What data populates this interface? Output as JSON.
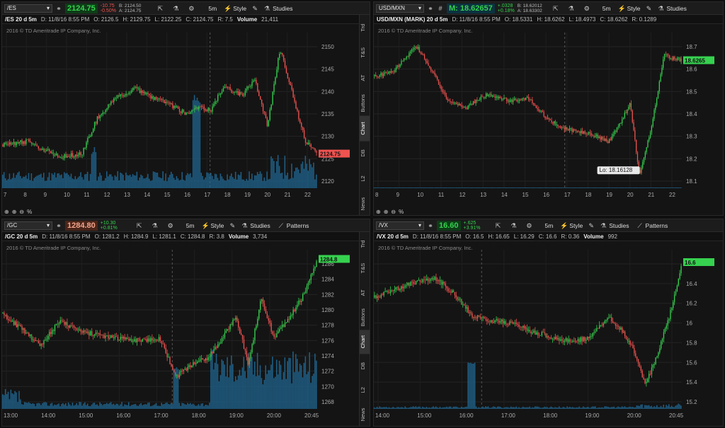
{
  "panels": [
    {
      "id": "es",
      "symbol": "/ES",
      "price": "2124.75",
      "price_color": "#36d14f",
      "change": "-10.75",
      "change_pct": "-0.50%",
      "change_color": "#ef5350",
      "bid": "B: 2124.50",
      "ask": "A: 2124.75",
      "toolbar": [
        "5m",
        "Style",
        "Studies"
      ],
      "info_label": "/ES 20 d 5m",
      "info": [
        "D: 11/8/16 8:55 PM",
        "O: 2126.5",
        "H: 2129.75",
        "L: 2122.25",
        "C: 2124.75",
        "R: 7.5",
        "Volume",
        "21,411"
      ],
      "copyright": "2016 © TD Ameritrade IP Company, Inc.",
      "y_ticks": [
        "2150",
        "2145",
        "2140",
        "2135",
        "2130",
        "2125",
        "2120"
      ],
      "x_ticks": [
        "7",
        "8",
        "9",
        "10",
        "11",
        "12",
        "13",
        "14",
        "15",
        "16",
        "17",
        "18",
        "19",
        "20",
        "21",
        "22"
      ],
      "last_label": "2124.75",
      "last_color": "#ef5350",
      "side_tabs": [
        "Trd",
        "T&S",
        "AT",
        "Buttons",
        "Chart",
        "DB",
        "L2",
        "News"
      ]
    },
    {
      "id": "usdmxn",
      "symbol": "USD/MXN",
      "price": "M: 18.62657",
      "price_color": "#36d14f",
      "change": "+.0328",
      "change_pct": "+0.18%",
      "change_color": "#36d14f",
      "bid": "B: 18.62012",
      "ask": "A: 18.63302",
      "toolbar": [
        "5m",
        "Style",
        "Studies"
      ],
      "info_label": "USD/MXN (MARK) 20 d 5m",
      "info": [
        "D: 11/8/16 8:55 PM",
        "O: 18.5331",
        "H: 18.6262",
        "L: 18.4973",
        "C: 18.6262",
        "R: 0.1289"
      ],
      "copyright": "2016 © TD Ameritrade IP Company, Inc.",
      "y_ticks": [
        "18.7",
        "18.6",
        "18.5",
        "18.4",
        "18.3",
        "18.2",
        "18.1"
      ],
      "x_ticks": [
        "8",
        "9",
        "10",
        "11",
        "12",
        "13",
        "14",
        "15",
        "16",
        "17",
        "18",
        "19",
        "20",
        "21",
        "22"
      ],
      "last_label": "18.6265",
      "last_color": "#36d14f",
      "lo_label": "Lo: 18.16128",
      "side_tabs": []
    },
    {
      "id": "gc",
      "symbol": "/GC",
      "price": "1284.80",
      "price_color": "#f2a48c",
      "change": "+10.30",
      "change_pct": "+0.81%",
      "change_color": "#36d14f",
      "bid": "",
      "ask": "",
      "toolbar": [
        "5m",
        "Style",
        "Studies",
        "Patterns"
      ],
      "info_label": "/GC 20 d 5m",
      "info": [
        "D: 11/8/16 8:55 PM",
        "O: 1281.2",
        "H: 1284.9",
        "L: 1281.1",
        "C: 1284.8",
        "R: 3.8",
        "Volume",
        "3,734"
      ],
      "copyright": "2016 © TD Ameritrade IP Company, Inc.",
      "y_ticks": [
        "1286",
        "1284",
        "1282",
        "1280",
        "1278",
        "1276",
        "1274",
        "1272",
        "1270",
        "1268"
      ],
      "x_ticks": [
        "13:00",
        "14:00",
        "15:00",
        "16:00",
        "17:00",
        "18:00",
        "19:00",
        "20:00",
        "20:45"
      ],
      "last_label": "1284.8",
      "last_color": "#36d14f",
      "side_tabs": [
        "Trd",
        "T&S",
        "AT",
        "Buttons",
        "Chart",
        "DB",
        "L2",
        "News"
      ]
    },
    {
      "id": "vx",
      "symbol": "/VX",
      "price": "16.60",
      "price_color": "#36d14f",
      "change": "+.625",
      "change_pct": "+3.91%",
      "change_color": "#36d14f",
      "bid": "",
      "ask": "",
      "toolbar": [
        "5m",
        "Style",
        "Studies",
        "Patterns"
      ],
      "info_label": "/VX 20 d 5m",
      "info": [
        "D: 11/8/16 8:55 PM",
        "O: 16.5",
        "H: 16.65",
        "L: 16.29",
        "C: 16.6",
        "R: 0.36",
        "Volume",
        "992"
      ],
      "copyright": "2016 © TD Ameritrade IP Company, Inc.",
      "y_ticks": [
        "16.6",
        "16.4",
        "16.2",
        "16",
        "15.8",
        "15.6",
        "15.4",
        "15.2"
      ],
      "x_ticks": [
        "14:00",
        "15:00",
        "16:00",
        "17:00",
        "18:00",
        "19:00",
        "20:00",
        "20:45"
      ],
      "last_label": "16.6",
      "last_color": "#36d14f",
      "side_tabs": []
    }
  ],
  "colors": {
    "up": "#36d14f",
    "down": "#ef5350",
    "volume": "#1f5f86"
  }
}
